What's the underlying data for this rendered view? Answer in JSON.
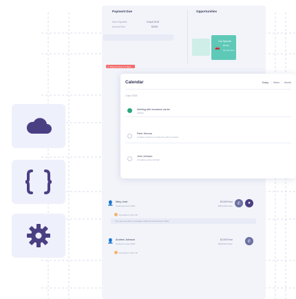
{
  "payment_due": {
    "title": "Payment Due",
    "next_payment_label": "Next Payment",
    "next_payment_value": "5 April 2018",
    "amount_due_label": "Amount Due",
    "amount_due_value": "$2000",
    "alert": "Payment due in 2 days"
  },
  "opportunities": {
    "title": "Opportunities",
    "card_title": "Car Special",
    "card_value": "$410m",
    "card_link": "Set this plan"
  },
  "calendar": {
    "title": "Calendar",
    "tabs": [
      "Today",
      "Week",
      "Month"
    ],
    "date": "3 Apr 2018",
    "events": [
      {
        "title": "Meeting with insurance carrier",
        "sub": "3:00pm"
      },
      {
        "title": "Peter Herrera",
        "sub": "Contact customer to close the policy renewal"
      },
      {
        "title": "John Johnson",
        "sub": "Complete policy contract"
      }
    ]
  },
  "list": {
    "rows": [
      {
        "name": "Mary Josh",
        "sub": "Customer since 2015",
        "value": "$2,000/Year",
        "value2": "$500,000 Claim",
        "status": "Renewal on April 15",
        "note": "The new car policy coverages might be interesting for Mary"
      },
      {
        "name": "Andrew Johnson",
        "sub": "Customer since 2016",
        "value": "$2,000/Year",
        "value2": "$500,000 Claim",
        "status": "Renewal on April 18",
        "note": ""
      }
    ]
  },
  "colors": {
    "accent": "#5fc9b8",
    "tile_bg": "#eef0fb",
    "icon": "#4b3f83",
    "alert": "#f36d6d",
    "warning": "#f5b26b"
  },
  "icons": [
    "cloud-icon",
    "braces-icon",
    "gear-icon"
  ]
}
